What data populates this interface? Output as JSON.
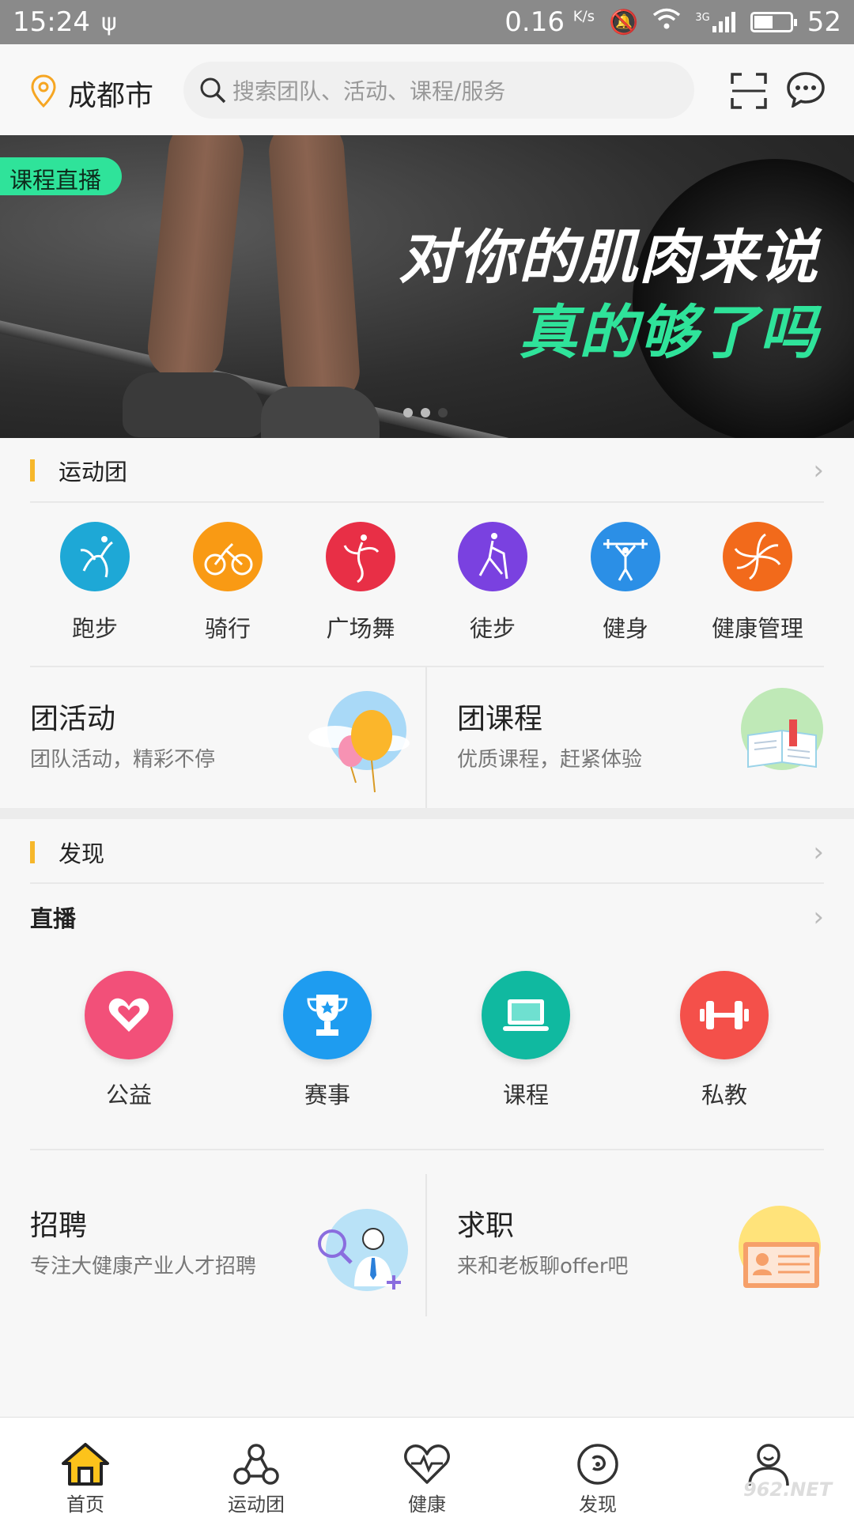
{
  "status_bar": {
    "time": "15:24",
    "net_speed": "0.16",
    "net_unit": "K/s",
    "network": "3G",
    "battery": "52",
    "battery_level": 0.52
  },
  "header": {
    "city": "成都市",
    "search_placeholder": "搜索团队、活动、课程/服务"
  },
  "banner": {
    "tag": "课程直播",
    "line1": "对你的肌肉来说",
    "line2": "真的够了吗",
    "slide_count": 3,
    "active_slide": 3
  },
  "sports_group": {
    "title": "运动团",
    "categories": [
      {
        "label": "跑步",
        "color": "#1ea8d6"
      },
      {
        "label": "骑行",
        "color": "#f99a14"
      },
      {
        "label": "广场舞",
        "color": "#e82f46"
      },
      {
        "label": "徒步",
        "color": "#7a41e0"
      },
      {
        "label": "健身",
        "color": "#2b8fe6"
      },
      {
        "label": "健康管理",
        "color": "#f26a1b"
      }
    ],
    "cards": [
      {
        "title": "团活动",
        "subtitle": "团队活动，精彩不停"
      },
      {
        "title": "团课程",
        "subtitle": "优质课程，赶紧体验"
      }
    ]
  },
  "discover": {
    "title": "发现",
    "live_title": "直播",
    "items": [
      {
        "label": "公益",
        "color": "#f25079",
        "icon": "heart-icon"
      },
      {
        "label": "赛事",
        "color": "#1e9cf0",
        "icon": "trophy-icon"
      },
      {
        "label": "课程",
        "color": "#10b9a0",
        "icon": "laptop-icon"
      },
      {
        "label": "私教",
        "color": "#f4504a",
        "icon": "dumbbell-icon"
      }
    ],
    "cards": [
      {
        "title": "招聘",
        "subtitle": "专注大健康产业人才招聘"
      },
      {
        "title": "求职",
        "subtitle": "来和老板聊offer吧"
      }
    ]
  },
  "tabbar": {
    "tabs": [
      {
        "label": "首页",
        "icon": "home-icon"
      },
      {
        "label": "运动团",
        "icon": "group-icon"
      },
      {
        "label": "健康",
        "icon": "heartbeat-icon"
      },
      {
        "label": "发现",
        "icon": "compass-icon"
      },
      {
        "label": "",
        "icon": "profile-icon"
      }
    ]
  },
  "watermark": "962.NET"
}
